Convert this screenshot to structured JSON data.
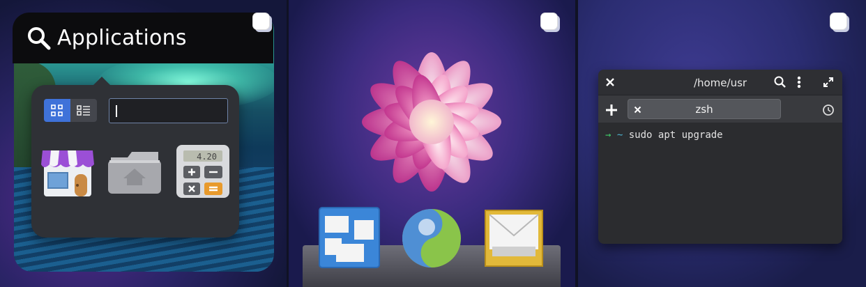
{
  "panels": {
    "applications": {
      "title": "Applications",
      "search_icon": "search-icon",
      "view_modes": [
        "grid-view-icon",
        "list-view-icon"
      ],
      "search_value": "",
      "apps": [
        "store-icon",
        "home-folder-icon",
        "calculator-icon"
      ],
      "calculator_display": "4.20"
    },
    "dock": {
      "icons": [
        "workspace-switcher-icon",
        "browser-globe-icon",
        "mail-inbox-icon"
      ]
    },
    "terminal": {
      "title": "/home/usr",
      "tab_label": "zsh",
      "prompt_arrow": "→",
      "prompt_tilde": "~",
      "command": "sudo apt upgrade"
    }
  },
  "colors": {
    "accent_blue": "#3f72d9",
    "terminal_bg": "#2b2c2f",
    "prompt_green": "#3fcf6a",
    "prompt_cyan": "#4fb6d2"
  }
}
